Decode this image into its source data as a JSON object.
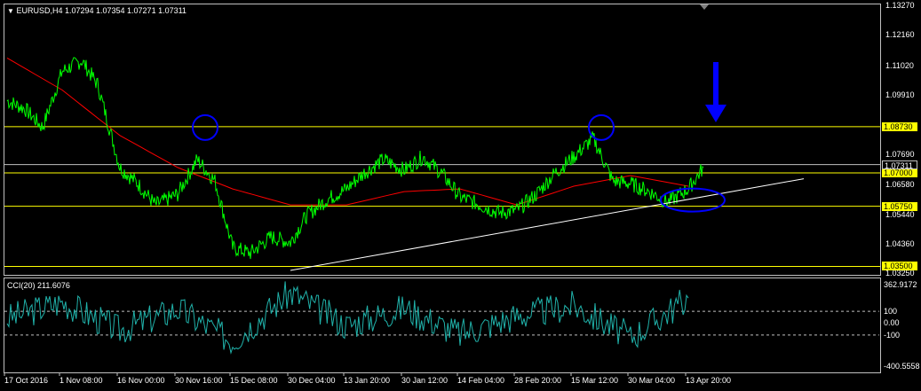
{
  "header": {
    "symbol": "EURUSD,H4",
    "ohlc": "1.07294 1.07354 1.07271 1.07311",
    "collapse_icon": "triangle-down-icon"
  },
  "indicator": {
    "label": "CCI(20) 211.6076"
  },
  "price_axis": {
    "ticks": [
      "1.13270",
      "1.12160",
      "1.11020",
      "1.09910",
      "1.08730",
      "1.07690",
      "1.07311",
      "1.07000",
      "1.06580",
      "1.05750",
      "1.05440",
      "1.04360",
      "1.03500",
      "1.03250"
    ]
  },
  "cci_axis": {
    "ticks": [
      "362.9172",
      "100",
      "0.00",
      "-100",
      "-400.5558"
    ]
  },
  "time_axis": {
    "ticks": [
      "17 Oct 2016",
      "1 Nov 08:00",
      "16 Nov 00:00",
      "30 Nov 16:00",
      "15 Dec 08:00",
      "30 Dec 04:00",
      "13 Jan 20:00",
      "30 Jan 12:00",
      "14 Feb 04:00",
      "28 Feb 20:00",
      "15 Mar 12:00",
      "30 Mar 04:00",
      "13 Apr 20:00"
    ]
  },
  "levels": {
    "lines": [
      {
        "value": 1.0873,
        "label": "1.08730",
        "color": "#ffff00"
      },
      {
        "value": 1.07,
        "label": "1.07000",
        "color": "#ffff00"
      },
      {
        "value": 1.0575,
        "label": "1.05750",
        "color": "#ffff00"
      },
      {
        "value": 1.035,
        "label": "1.03500",
        "color": "#ffff00"
      }
    ],
    "current": {
      "value": 1.07311,
      "label": "1.07311",
      "color": "#c0c0c0"
    }
  },
  "colors": {
    "background": "#000000",
    "price_line": "#00ff00",
    "moving_average": "#ff0000",
    "cci_line": "#20b2aa",
    "trendline": "#ffffff",
    "annotation": "#0000ff",
    "level": "#ffff00"
  },
  "chart_data": {
    "type": "line",
    "series": [
      {
        "x": [
          "17 Oct 2016",
          "20 Oct",
          "25 Oct",
          "1 Nov 08:00",
          "4 Nov",
          "9 Nov",
          "16 Nov 00:00",
          "20 Nov",
          "25 Nov",
          "30 Nov 16:00",
          "5 Dec",
          "10 Dec",
          "15 Dec 08:00",
          "20 Dec",
          "25 Dec",
          "30 Dec 04:00",
          "5 Jan",
          "10 Jan",
          "13 Jan 20:00",
          "20 Jan",
          "25 Jan",
          "30 Jan 12:00",
          "5 Feb",
          "10 Feb",
          "14 Feb 04:00",
          "20 Feb",
          "25 Feb",
          "28 Feb 20:00",
          "5 Mar",
          "10 Mar",
          "15 Mar 12:00",
          "20 Mar",
          "25 Mar",
          "30 Mar 04:00",
          "5 Apr",
          "10 Apr",
          "13 Apr 20:00",
          "17 Apr"
        ],
        "values": [
          1.097,
          1.094,
          1.087,
          1.108,
          1.112,
          1.103,
          1.072,
          1.066,
          1.058,
          1.062,
          1.075,
          1.067,
          1.042,
          1.04,
          1.046,
          1.044,
          1.054,
          1.06,
          1.064,
          1.07,
          1.075,
          1.071,
          1.076,
          1.07,
          1.061,
          1.058,
          1.055,
          1.056,
          1.062,
          1.07,
          1.076,
          1.083,
          1.067,
          1.066,
          1.063,
          1.059,
          1.064,
          1.072
        ]
      },
      {
        "x": [
          "17 Oct 2016",
          "1 Nov 08:00",
          "16 Nov 00:00",
          "30 Nov 16:00",
          "15 Dec 08:00",
          "30 Dec 04:00",
          "13 Jan 20:00",
          "30 Jan 12:00",
          "14 Feb 04:00",
          "28 Feb 20:00",
          "15 Mar 12:00",
          "30 Mar 04:00",
          "13 Apr 20:00"
        ],
        "values": [
          1.113,
          1.101,
          1.084,
          1.072,
          1.064,
          1.058,
          1.058,
          1.063,
          1.064,
          1.058,
          1.065,
          1.069,
          1.065
        ]
      }
    ],
    "cci": {
      "x": [
        "17 Oct 2016",
        "1 Nov 08:00",
        "16 Nov 00:00",
        "30 Nov 16:00",
        "15 Dec 08:00",
        "30 Dec 04:00",
        "13 Jan 20:00",
        "30 Jan 12:00",
        "14 Feb 04:00",
        "28 Feb 20:00",
        "15 Mar 12:00",
        "30 Mar 04:00",
        "13 Apr 20:00"
      ],
      "values": [
        40,
        180,
        -60,
        120,
        -150,
        260,
        -20,
        130,
        -90,
        60,
        150,
        -120,
        212
      ],
      "ylim": [
        -400.5558,
        362.9172
      ],
      "levels": [
        100,
        -100
      ]
    },
    "ylim": [
      1.0325,
      1.1327
    ],
    "trendline": {
      "from": [
        "30 Dec 04:00",
        1.0335
      ],
      "to": [
        "17 Apr",
        1.0678
      ]
    },
    "annotations": [
      {
        "type": "circle",
        "at": "30 Nov 16:00",
        "value": 1.0873
      },
      {
        "type": "circle",
        "at": "15 Mar 12:00",
        "value": 1.0873
      },
      {
        "type": "ellipse",
        "at": "13 Apr 20:00",
        "value": 1.0575
      },
      {
        "type": "arrow-down",
        "at": "13 Apr 20:00"
      }
    ]
  }
}
